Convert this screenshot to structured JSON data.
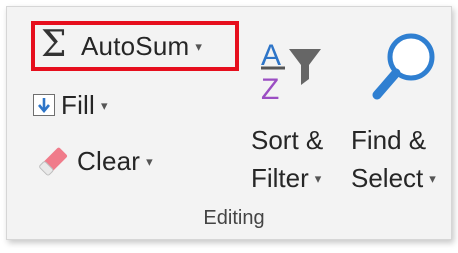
{
  "ribbon_group": {
    "title": "Editing",
    "autosum": {
      "symbol": "Σ",
      "label": "AutoSum",
      "caret": "▾"
    },
    "fill": {
      "label": "Fill",
      "caret": "▾"
    },
    "clear": {
      "label": "Clear",
      "caret": "▾"
    },
    "sort_filter": {
      "line1": "Sort &",
      "line2": "Filter",
      "caret": "▾",
      "icon_letters": [
        "A",
        "Z"
      ]
    },
    "find_select": {
      "line1": "Find &",
      "line2": "Select",
      "caret": "▾"
    }
  },
  "colors": {
    "highlight_border": "#e60e1d",
    "sort_a": "#2e75c8",
    "sort_z": "#9b4ec3",
    "fill_arrow": "#2e75c8",
    "eraser": "#f07b8a",
    "magnifier": "#2f7fd1"
  },
  "icons": [
    "sigma-icon",
    "fill-down-icon",
    "eraser-icon",
    "sort-az-icon",
    "filter-funnel-icon",
    "magnifier-icon"
  ]
}
